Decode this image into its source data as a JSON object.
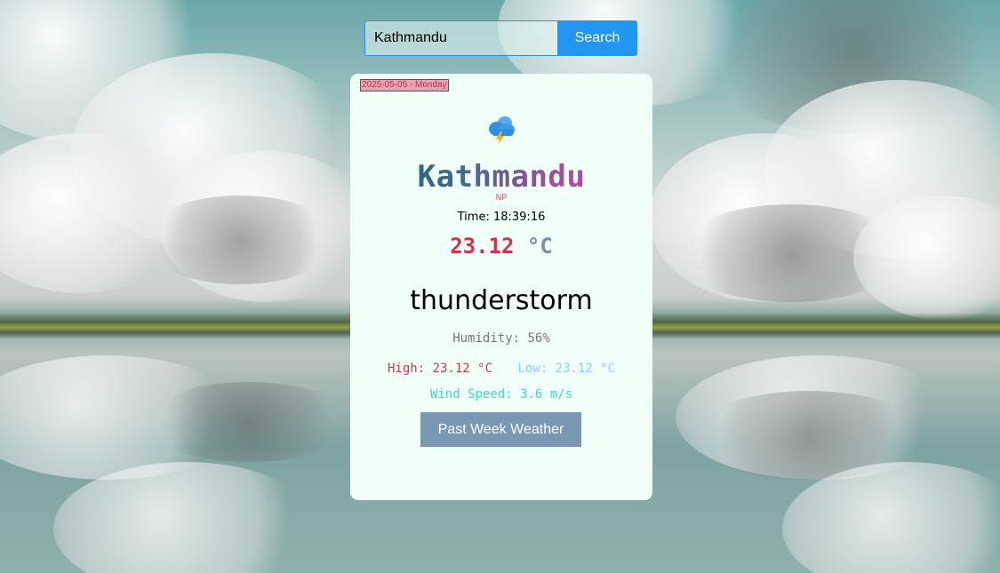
{
  "search": {
    "value": "Kathmandu",
    "button_label": "Search"
  },
  "card": {
    "date": "2025-05-05 - Monday",
    "weather_icon": "thunderstorm-cloud-icon",
    "city": "Kathmandu",
    "country": "NP",
    "time_label": "Time:",
    "time_value": "18:39:16",
    "temperature": "23.12",
    "temperature_unit": "°C",
    "condition": "thunderstorm",
    "humidity_label": "Humidity:",
    "humidity_value": "56%",
    "high_label": "High:",
    "high_value": "23.12 °C",
    "low_label": "Low:",
    "low_value": "23.12 °C",
    "wind_label": "Wind Speed:",
    "wind_value": "3.6 m/s",
    "past_week_button": "Past Week Weather"
  },
  "colors": {
    "search_button": "#2196f3",
    "card_background": "#f0fff8",
    "temperature": "#d0334d",
    "low": "#8ec9ff",
    "wind": "#40d3c8",
    "past_week_button": "#7a97b4"
  }
}
